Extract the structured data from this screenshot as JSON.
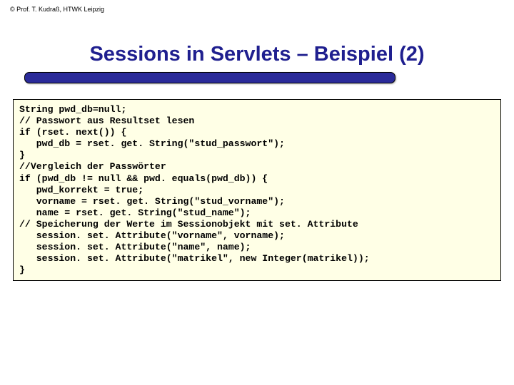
{
  "copyright": "©   Prof. T. Kudraß, HTWK Leipzig",
  "title": "Sessions in Servlets – Beispiel (2)",
  "code": "String pwd_db=null;\n// Passwort aus Resultset lesen\nif (rset. next()) {\n   pwd_db = rset. get. String(\"stud_passwort\");\n}\n//Vergleich der Passwörter\nif (pwd_db != null && pwd. equals(pwd_db)) {\n   pwd_korrekt = true;\n   vorname = rset. get. String(\"stud_vorname\");\n   name = rset. get. String(\"stud_name\");\n// Speicherung der Werte im Sessionobjekt mit set. Attribute\n   session. set. Attribute(\"vorname\", vorname);\n   session. set. Attribute(\"name\", name);\n   session. set. Attribute(\"matrikel\", new Integer(matrikel));\n}"
}
